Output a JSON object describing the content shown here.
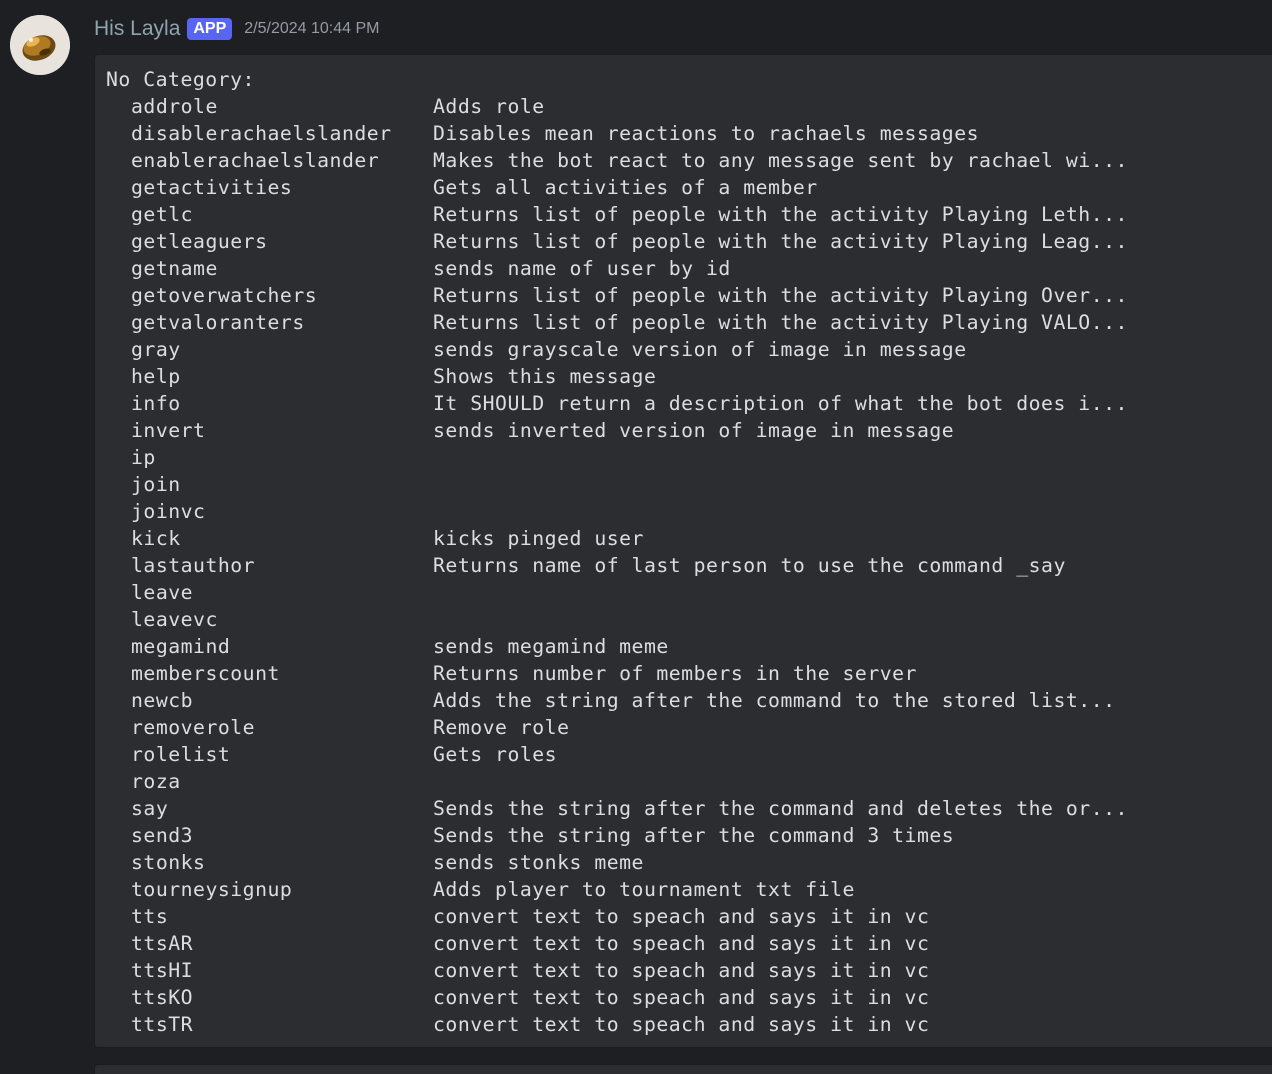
{
  "message": {
    "username": "His Layla",
    "badge": "APP",
    "timestamp": "2/5/2024 10:44 PM",
    "avatar_icon": "bot-avatar-icon",
    "code_header": "No Category:",
    "commands": [
      {
        "name": "addrole",
        "desc": "Adds role"
      },
      {
        "name": "disablerachaelslander",
        "desc": "Disables mean reactions to rachaels messages"
      },
      {
        "name": "enablerachaelslander",
        "desc": "Makes the bot react to any message sent by rachael wi..."
      },
      {
        "name": "getactivities",
        "desc": "Gets all activities of a member"
      },
      {
        "name": "getlc",
        "desc": "Returns list of people with the activity Playing Leth..."
      },
      {
        "name": "getleaguers",
        "desc": "Returns list of people with the activity Playing Leag..."
      },
      {
        "name": "getname",
        "desc": "sends name of user by id"
      },
      {
        "name": "getoverwatchers",
        "desc": "Returns list of people with the activity Playing Over..."
      },
      {
        "name": "getvaloranters",
        "desc": "Returns list of people with the activity Playing VALO..."
      },
      {
        "name": "gray",
        "desc": "sends grayscale version of image in message"
      },
      {
        "name": "help",
        "desc": "Shows this message"
      },
      {
        "name": "info",
        "desc": "It SHOULD return a description of what the bot does i..."
      },
      {
        "name": "invert",
        "desc": "sends inverted version of image in message"
      },
      {
        "name": "ip",
        "desc": ""
      },
      {
        "name": "join",
        "desc": ""
      },
      {
        "name": "joinvc",
        "desc": ""
      },
      {
        "name": "kick",
        "desc": "kicks pinged user"
      },
      {
        "name": "lastauthor",
        "desc": "Returns name of last person to use the command _say"
      },
      {
        "name": "leave",
        "desc": ""
      },
      {
        "name": "leavevc",
        "desc": ""
      },
      {
        "name": "megamind",
        "desc": "sends megamind meme"
      },
      {
        "name": "memberscount",
        "desc": "Returns number of members in the server"
      },
      {
        "name": "newcb",
        "desc": "Adds the string after the command to the stored list..."
      },
      {
        "name": "removerole",
        "desc": "Remove role"
      },
      {
        "name": "rolelist",
        "desc": "Gets roles"
      },
      {
        "name": "roza",
        "desc": ""
      },
      {
        "name": "say",
        "desc": "Sends the string after the command and deletes the or..."
      },
      {
        "name": "send3",
        "desc": "Sends the string after the command 3 times"
      },
      {
        "name": "stonks",
        "desc": "sends stonks meme"
      },
      {
        "name": "tourneysignup",
        "desc": "Adds player to tournament txt file"
      },
      {
        "name": "tts",
        "desc": "convert text to speach and says it in vc"
      },
      {
        "name": "ttsAR",
        "desc": "convert text to speach and says it in vc"
      },
      {
        "name": "ttsHI",
        "desc": "convert text to speach and says it in vc"
      },
      {
        "name": "ttsKO",
        "desc": "convert text to speach and says it in vc"
      },
      {
        "name": "ttsTR",
        "desc": "convert text to speach and says it in vc"
      }
    ]
  },
  "colors": {
    "background": "#1e1f22",
    "codeblock": "#2b2d31",
    "username": "#90a4ae",
    "badge": "#5865f2",
    "text": "#dbdee1",
    "timestamp": "#949ba4"
  }
}
